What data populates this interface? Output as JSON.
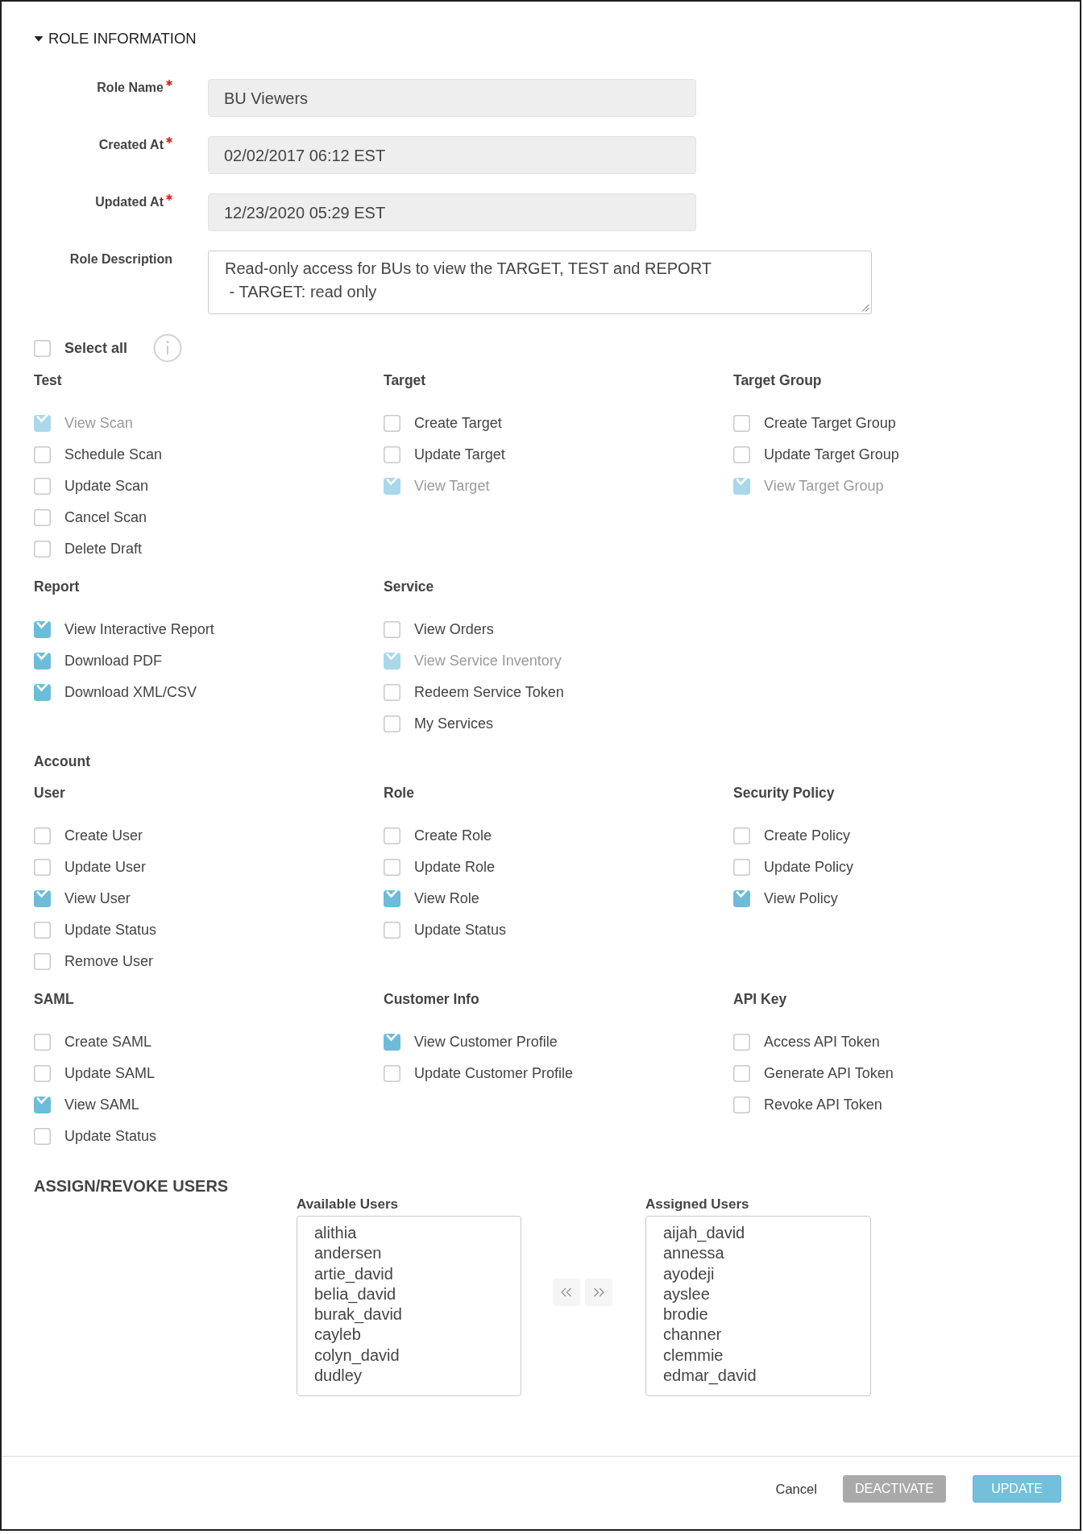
{
  "section": {
    "title": "ROLE INFORMATION",
    "expanded": true
  },
  "fields": [
    {
      "label": "Role Name",
      "required": true,
      "kind": "input",
      "value": "BU Viewers"
    },
    {
      "label": "Created At",
      "required": true,
      "kind": "input",
      "value": "02/02/2017 06:12 EST"
    },
    {
      "label": "Updated At",
      "required": true,
      "kind": "input",
      "value": "12/23/2020 05:29 EST"
    },
    {
      "label": "Role Description",
      "required": false,
      "kind": "textarea",
      "value": "Read-only access for BUs to view the TARGET, TEST and REPORT\n - TARGET: read only"
    }
  ],
  "select_all": {
    "label": "Select all",
    "checked": false
  },
  "permission_sections": [
    {
      "groups": [
        {
          "title": "Test",
          "permissions": [
            {
              "label": "View Scan",
              "checked": true,
              "disabled": true
            },
            {
              "label": "Schedule Scan",
              "checked": false,
              "disabled": false
            },
            {
              "label": "Update Scan",
              "checked": false,
              "disabled": false
            },
            {
              "label": "Cancel Scan",
              "checked": false,
              "disabled": false
            },
            {
              "label": "Delete Draft",
              "checked": false,
              "disabled": false
            }
          ]
        },
        {
          "title": "Target",
          "permissions": [
            {
              "label": "Create Target",
              "checked": false,
              "disabled": false
            },
            {
              "label": "Update Target",
              "checked": false,
              "disabled": false
            },
            {
              "label": "View Target",
              "checked": true,
              "disabled": true
            }
          ]
        },
        {
          "title": "Target Group",
          "permissions": [
            {
              "label": "Create Target Group",
              "checked": false,
              "disabled": false
            },
            {
              "label": "Update Target Group",
              "checked": false,
              "disabled": false
            },
            {
              "label": "View Target Group",
              "checked": true,
              "disabled": true
            }
          ]
        },
        {
          "title": "Report",
          "permissions": [
            {
              "label": "View Interactive Report",
              "checked": true,
              "disabled": false
            },
            {
              "label": "Download PDF",
              "checked": true,
              "disabled": false
            },
            {
              "label": "Download XML/CSV",
              "checked": true,
              "disabled": false
            }
          ]
        },
        {
          "title": "Service",
          "permissions": [
            {
              "label": "View Orders",
              "checked": false,
              "disabled": false
            },
            {
              "label": "View Service Inventory",
              "checked": true,
              "disabled": true
            },
            {
              "label": "Redeem Service Token",
              "checked": false,
              "disabled": false
            },
            {
              "label": "My Services",
              "checked": false,
              "disabled": false
            }
          ]
        }
      ]
    },
    {
      "title": "Account",
      "groups": [
        {
          "title": "User",
          "permissions": [
            {
              "label": "Create User",
              "checked": false,
              "disabled": false
            },
            {
              "label": "Update User",
              "checked": false,
              "disabled": false
            },
            {
              "label": "View User",
              "checked": true,
              "disabled": false
            },
            {
              "label": "Update Status",
              "checked": false,
              "disabled": false
            },
            {
              "label": "Remove User",
              "checked": false,
              "disabled": false
            }
          ]
        },
        {
          "title": "Role",
          "permissions": [
            {
              "label": "Create Role",
              "checked": false,
              "disabled": false
            },
            {
              "label": "Update Role",
              "checked": false,
              "disabled": false
            },
            {
              "label": "View Role",
              "checked": true,
              "disabled": false
            },
            {
              "label": "Update Status",
              "checked": false,
              "disabled": false
            }
          ]
        },
        {
          "title": "Security Policy",
          "permissions": [
            {
              "label": "Create Policy",
              "checked": false,
              "disabled": false
            },
            {
              "label": "Update Policy",
              "checked": false,
              "disabled": false
            },
            {
              "label": "View Policy",
              "checked": true,
              "disabled": false
            }
          ]
        },
        {
          "title": "SAML",
          "permissions": [
            {
              "label": "Create SAML",
              "checked": false,
              "disabled": false
            },
            {
              "label": "Update SAML",
              "checked": false,
              "disabled": false
            },
            {
              "label": "View SAML",
              "checked": true,
              "disabled": false
            },
            {
              "label": "Update Status",
              "checked": false,
              "disabled": false
            }
          ]
        },
        {
          "title": "Customer Info",
          "permissions": [
            {
              "label": "View Customer Profile",
              "checked": true,
              "disabled": false
            },
            {
              "label": "Update Customer Profile",
              "checked": false,
              "disabled": false
            }
          ]
        },
        {
          "title": "API Key",
          "permissions": [
            {
              "label": "Access API Token",
              "checked": false,
              "disabled": false
            },
            {
              "label": "Generate API Token",
              "checked": false,
              "disabled": false
            },
            {
              "label": "Revoke API Token",
              "checked": false,
              "disabled": false
            }
          ]
        }
      ]
    }
  ],
  "assign_users": {
    "title": "ASSIGN/REVOKE USERS",
    "available": {
      "label": "Available Users",
      "items": [
        "alithia",
        "andersen",
        "artie_david",
        "belia_david",
        "burak_david",
        "cayleb",
        "colyn_david",
        "dudley"
      ]
    },
    "assigned": {
      "label": "Assigned Users",
      "items": [
        "aijah_david",
        "annessa",
        "ayodeji",
        "ayslee",
        "brodie",
        "channer",
        "clemmie",
        "edmar_david"
      ]
    }
  },
  "footer_buttons": [
    {
      "label": "Cancel",
      "kind": "link",
      "disabled": false
    },
    {
      "label": "DEACTIVATE",
      "kind": "button",
      "disabled": true
    },
    {
      "label": "UPDATE",
      "kind": "button",
      "disabled": false
    }
  ]
}
